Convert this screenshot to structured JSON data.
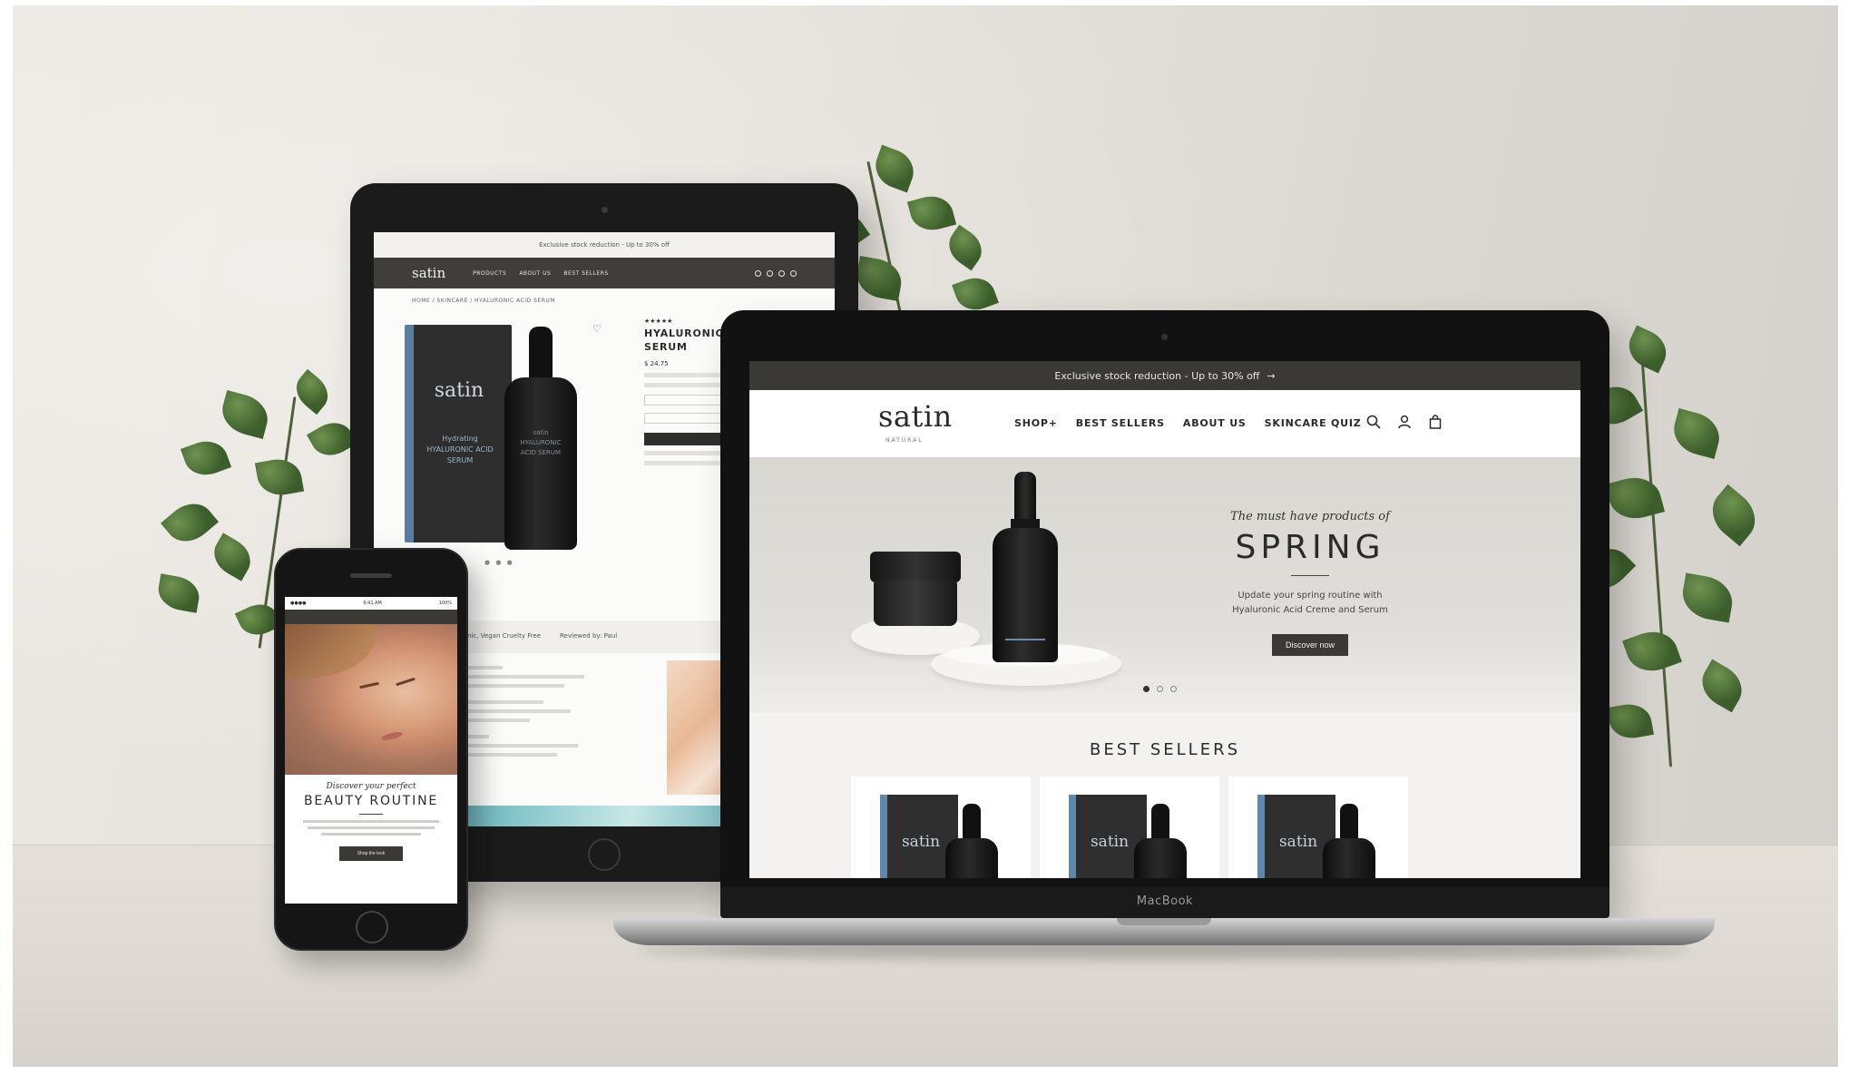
{
  "laptop": {
    "device_label": "MacBook",
    "announcement": "Exclusive stock reduction - Up to 30% off",
    "announcement_arrow": "→",
    "logo": "satin",
    "logo_sub": "NATURAL",
    "menu": [
      "SHOP+",
      "BEST SELLERS",
      "ABOUT US",
      "SKINCARE QUIZ"
    ],
    "icons": [
      "search-icon",
      "account-icon",
      "bag-icon"
    ],
    "hero": {
      "kicker": "The must have products of",
      "title": "SPRING",
      "description_line1": "Update your spring routine with",
      "description_line2": "Hyaluronic Acid Creme and Serum",
      "cta": "Discover now",
      "slides": 3,
      "active_slide": 1
    },
    "best_sellers": {
      "heading": "BEST SELLERS",
      "products": [
        {
          "brand": "satin"
        },
        {
          "brand": "satin"
        },
        {
          "brand": "satin"
        }
      ]
    }
  },
  "tablet": {
    "announcement": "Exclusive stock reduction - Up to 30% off",
    "logo": "satin",
    "menu": [
      "PRODUCTS",
      "ABOUT US",
      "BEST SELLERS"
    ],
    "breadcrumb": "HOME  /  SKINCARE  /  HYALURONIC ACID SERUM",
    "product": {
      "box_brand": "satin",
      "box_text": "Hydrating HYALURONIC ACID SERUM",
      "bottle_text": "satin HYALURONIC ACID SERUM",
      "rating": "★★★★★",
      "name_line1": "HYALURONIC ACID",
      "name_line2": "SERUM",
      "price": "$ 24.75"
    },
    "band_left": "Organic, Vegan Cruelty Free",
    "band_right": "Reviewed by: Paul"
  },
  "phone": {
    "status_left": "●●●● ",
    "status_time": "9:41 AM",
    "status_right": "100%",
    "kicker": "Discover your perfect",
    "title": "BEAUTY ROUTINE",
    "cta": "Shop the look"
  },
  "colors": {
    "dark_bar": "#3a3936",
    "hero_bg": "#d9d7d2",
    "accent_blue": "#5f86ab"
  }
}
